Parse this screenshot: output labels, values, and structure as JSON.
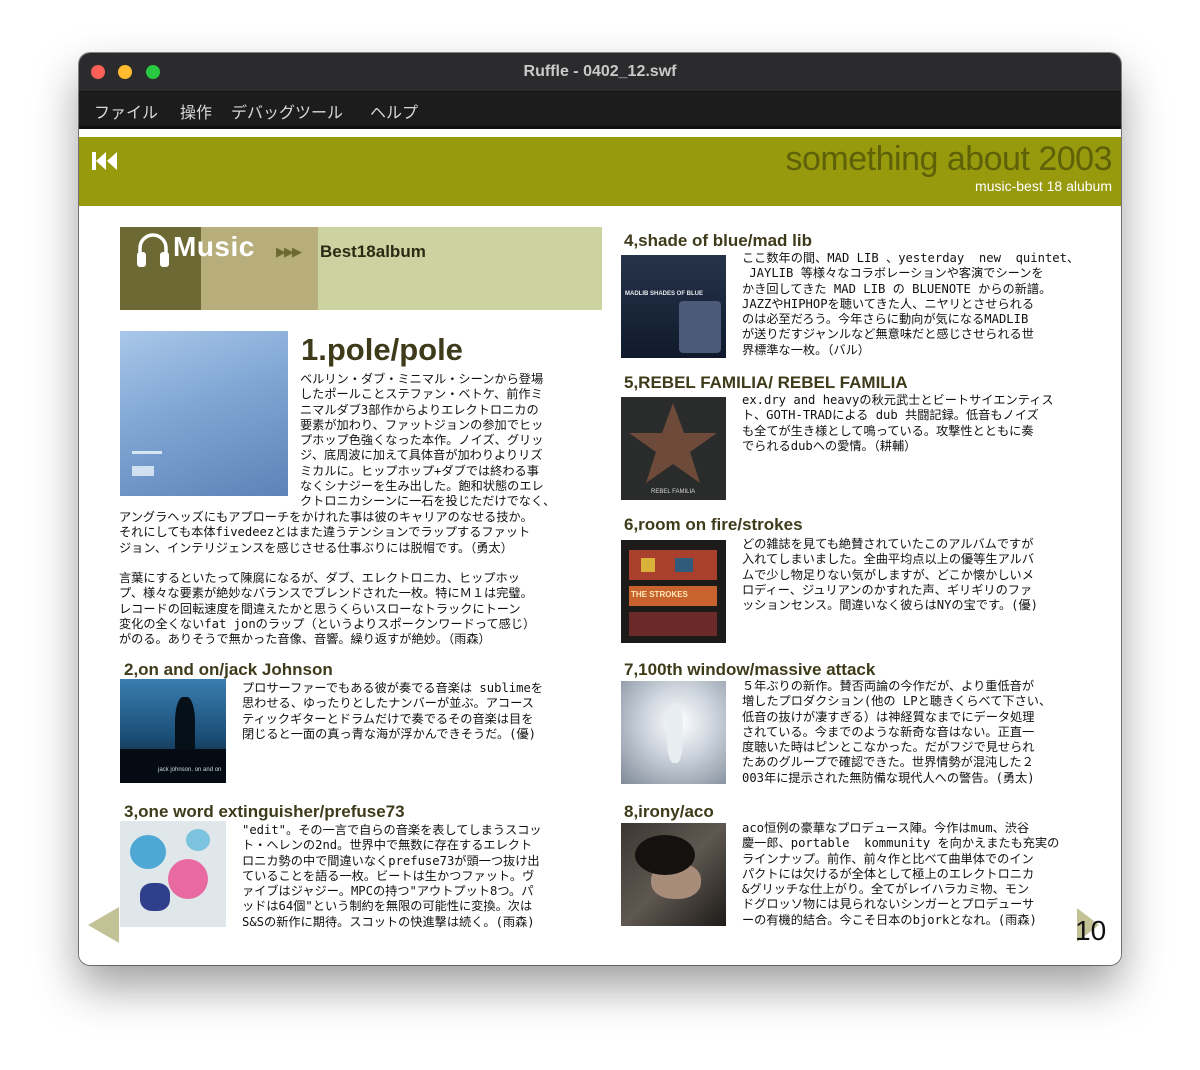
{
  "window": {
    "title": "Ruffle - 0402_12.swf"
  },
  "menu": [
    "ファイル",
    "操作",
    "デバッグツール",
    "ヘルプ"
  ],
  "site": {
    "title": "something about 2003",
    "subtitle": "music-best 18 alubum"
  },
  "section": {
    "music": "Music",
    "arrows": "▶▶▶",
    "best": "Best18album"
  },
  "albums": [
    {
      "title": "1.pole/pole",
      "text": "ベルリン・ダブ・ミニマル・シーンから登場\nしたポールことステファン・ベトケ、前作ミ\nニマルダブ3部作からよりエレクトロニカの\n要素が加わり、ファットジョンの参加でヒッ\nプホップ色強くなった本作。ノイズ、グリッ\nジ、底周波に加えて具体音が加わりよりリズ\nミカルに。ヒップホップ+ダブでは終わる事\nなくシナジーを生み出した。飽和状態のエレ\nクトロニカシーンに一石を投じただけでなく、",
      "text2": "アングラヘッズにもアプローチをかけれた事は彼のキャリアのなせる技か。\nそれにしても本体fivedeezとはまた違うテンションでラップするファット\nジョン、インテリジェンスを感じさせる仕事ぶりには脱帽です。（勇太）\n\n言葉にするといたって陳腐になるが、ダブ、エレクトロニカ、ヒップホッ\nプ、様々な要素が絶妙なバランスでブレンドされた一枚。特にＭ１は完璧。\nレコードの回転速度を間違えたかと思うくらいスローなトラックにトーン\n変化の全くないfat jonのラップ（というよりスポークンワードって感じ）\nがのる。ありそうで無かった音像、音響。繰り返すが絶妙。（雨森）"
    },
    {
      "title": "2,on and on/jack Johnson",
      "text": "プロサーファーでもある彼が奏でる音楽は sublimeを\n思わせる、ゆったりとしたナンバーが並ぶ。アコース\nティックギターとドラムだけで奏でるその音楽は目を\n閉じると一面の真っ青な海が浮かんできそうだ。(優)",
      "cover_text": "jack johnson. on and on"
    },
    {
      "title": "3,one word extinguisher/prefuse73",
      "text": "\"edit\"。その一言で自らの音楽を表してしまうスコッ\nト・ヘレンの2nd。世界中で無数に存在するエレクト\nロニカ勢の中で間違いなくprefuse73が頭一つ抜け出\nていることを語る一枚。ビートは生かつファット。ヴ\nァイブはジャジー。MPCの持つ\"アウトプット8つ。パ\nッドは64個\"という制約を無限の可能性に変換。次は\nS&Sの新作に期待。スコットの快進撃は続く。(雨森)"
    },
    {
      "title": "4,shade of blue/mad lib",
      "text": "ここ数年の間、MAD LIB 、yesterday  new  quintet、\n JAYLIB 等様々なコラボレーションや客演でシーンを\nかき回してきた MAD LIB の BLUENOTE からの新譜。\nJAZZやHIPHOPを聴いてきた人、ニヤリとさせられる\nのは必至だろう。今年さらに動向が気になるMADLIB\nが送りだすジャンルなど無意味だと感じさせられる世\n界標準な一枚。（バル）",
      "cover_text": "MADLIB SHADES OF BLUE"
    },
    {
      "title": "5,REBEL FAMILIA/ REBEL FAMILIA",
      "text": "ex.dry and heavyの秋元武士とビートサイエンティス\nト、GOTH-TRADによる dub 共闘記録。低音もノイズ\nも全てが生き様として鳴っている。攻撃性とともに奏\nでられるdubへの愛情。（耕輔）",
      "cover_text": "REBEL FAMILIA"
    },
    {
      "title": "6,room on fire/strokes",
      "text": "どの雑誌を見ても絶賛されていたこのアルバムですが\n入れてしまいました。全曲平均点以上の優等生アルバ\nムで少し物足りない気がしますが、どこか懐かしいメ\nロディー、ジュリアンのかすれた声、ギリギリのファ\nッションセンス。間違いなく彼らはNYの宝です。(優)",
      "cover_text": "THE STROKES"
    },
    {
      "title": "7,100th window/massive attack",
      "text": "５年ぶりの新作。賛否両論の今作だが、より重低音が\n増したプロダクション(他の LPと聴きくらべて下さい、\n低音の抜けが凄すぎる）は神経質なまでにデータ処理\nされている。今までのような新奇な音はない。正直一\n度聴いた時はピンとこなかった。だがフジで見せられ\nたあのグループで確認できた。世界情勢が混沌した２\n003年に提示された無防備な現代人への警告。(勇太)"
    },
    {
      "title": "8,irony/aco",
      "text": "aco恒例の豪華なプロデュース陣。今作はmum、渋谷\n慶一郎、portable  kommunity を向かえまたも充実の\nラインナップ。前作、前々作と比べて曲単体でのイン\nパクトには欠けるが全体として極上のエレクトロニカ\n&グリッチな仕上がり。全てがレイハラカミ物、モン\nドグロッソ物には見られないシンガーとプロデューサ\nーの有機的結合。今こそ日本のbjorkとなれ。(雨森)"
    }
  ],
  "page": {
    "number": "10"
  },
  "colors": {
    "banner": "#979a0d",
    "title": "#5e6108",
    "heading": "#3e3b1a"
  }
}
